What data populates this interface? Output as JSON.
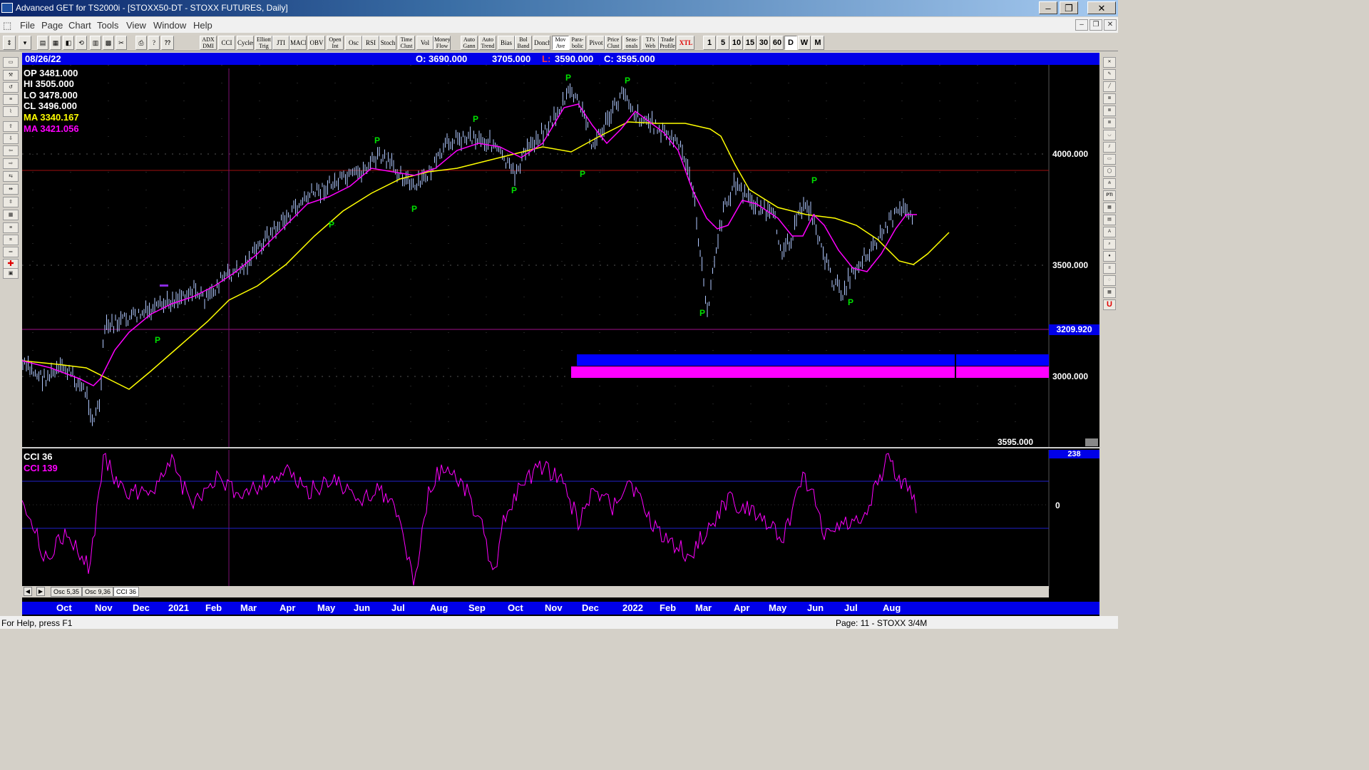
{
  "window": {
    "title": "Advanced GET for TS2000i - [STOXX50-DT - STOXX FUTURES, Daily]"
  },
  "menu": [
    "File",
    "Page",
    "Chart",
    "Tools",
    "View",
    "Window",
    "Help"
  ],
  "toolbar": {
    "study_buttons": [
      "ADX DMI",
      "CCI",
      "Cycles",
      "Elliott Trig",
      "JTI",
      "MACD",
      "OBV",
      "Open Int",
      "Osc",
      "RSI",
      "Stoch",
      "Time Clust",
      "Vol",
      "Money Flow",
      "Auto Gann",
      "Auto Trend",
      "Bias",
      "Bol Band",
      "Donch",
      "Mov Ave",
      "Para- bolic",
      "Pivot",
      "Price Clust",
      "Seas- onals",
      "TJ's Web",
      "Trade Profile",
      "XTL"
    ],
    "interval_buttons": [
      "1",
      "5",
      "10",
      "15",
      "30",
      "60",
      "D",
      "W",
      "M"
    ],
    "active_interval": "D"
  },
  "header": {
    "date": "08/26/22",
    "open": "O: 3690.000",
    "high": "3705.000",
    "low_label": "L:",
    "low": "3590.000",
    "close": "C: 3595.000"
  },
  "info": {
    "op": "OP  3481.000",
    "hi": "HI   3505.000",
    "lo": "LO  3478.000",
    "cl": "CL  3496.000",
    "ma1": "MA  3340.167",
    "ma2": "MA  3421.056"
  },
  "price_axis": {
    "labels": [
      "4000.000",
      "3500.000",
      "3000.000"
    ],
    "highlight_level": "3209.920",
    "last_price": "3595.000"
  },
  "cci_panel": {
    "title1": "CCI 36",
    "title2": "CCI  139",
    "top_value": "238",
    "zero_label": "0"
  },
  "tabs": [
    "Osc 5,35",
    "Osc 9,36",
    "CCI 36"
  ],
  "pivot_marker": "P",
  "date_axis": [
    "Oct",
    "Nov",
    "Dec",
    "2021",
    "Feb",
    "Mar",
    "Apr",
    "May",
    "Jun",
    "Jul",
    "Aug",
    "Sep",
    "Oct",
    "Nov",
    "Dec",
    "2022",
    "Feb",
    "Mar",
    "Apr",
    "May",
    "Jun",
    "Jul",
    "Aug"
  ],
  "status": {
    "help": "For Help, press F1",
    "page": "Page: 11 - STOXX 3/4M"
  },
  "colors": {
    "ma_fast": "#ff00ff",
    "ma_slow": "#ffff00",
    "price_bars": "#b0c8ff",
    "pivot": "#00e000",
    "panel_bg": "#000000",
    "header_bar": "#0000e8"
  }
}
